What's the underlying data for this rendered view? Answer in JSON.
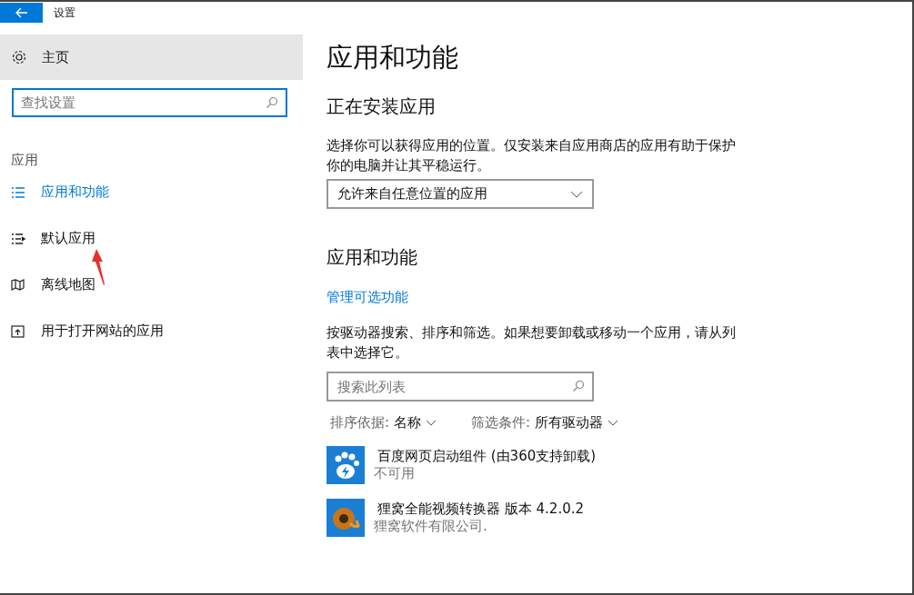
{
  "window": {
    "title": "设置"
  },
  "sidebar": {
    "home": "主页",
    "search": {
      "placeholder": "查找设置"
    },
    "section": "应用",
    "items": [
      {
        "label": "应用和功能",
        "selected": true,
        "kind": "list"
      },
      {
        "label": "默认应用",
        "selected": false,
        "kind": "defaults"
      },
      {
        "label": "离线地图",
        "selected": false,
        "kind": "map"
      },
      {
        "label": "用于打开网站的应用",
        "selected": false,
        "kind": "web"
      }
    ]
  },
  "main": {
    "title": "应用和功能",
    "install": {
      "heading": "正在安装应用",
      "description": "选择你可以获得应用的位置。仅安装来自应用商店的应用有助于保护你的电脑并让其平稳运行。",
      "dropdown": "允许来自任意位置的应用"
    },
    "apps": {
      "heading": "应用和功能",
      "link": "管理可选功能",
      "description": "按驱动器搜索、排序和筛选。如果想要卸载或移动一个应用，请从列表中选择它。",
      "search": {
        "placeholder": "搜索此列表"
      },
      "sort": {
        "label": "排序依据:",
        "value": "名称"
      },
      "filter": {
        "label": "筛选条件:",
        "value": "所有驱动器"
      },
      "list": [
        {
          "name": "百度网页启动组件 (由360支持卸载)",
          "detail": "不可用",
          "kind": "paw"
        },
        {
          "name": "狸窝全能视频转换器 版本  4.2.0.2",
          "detail": "狸窝软件有限公司.",
          "kind": "film"
        }
      ]
    }
  }
}
